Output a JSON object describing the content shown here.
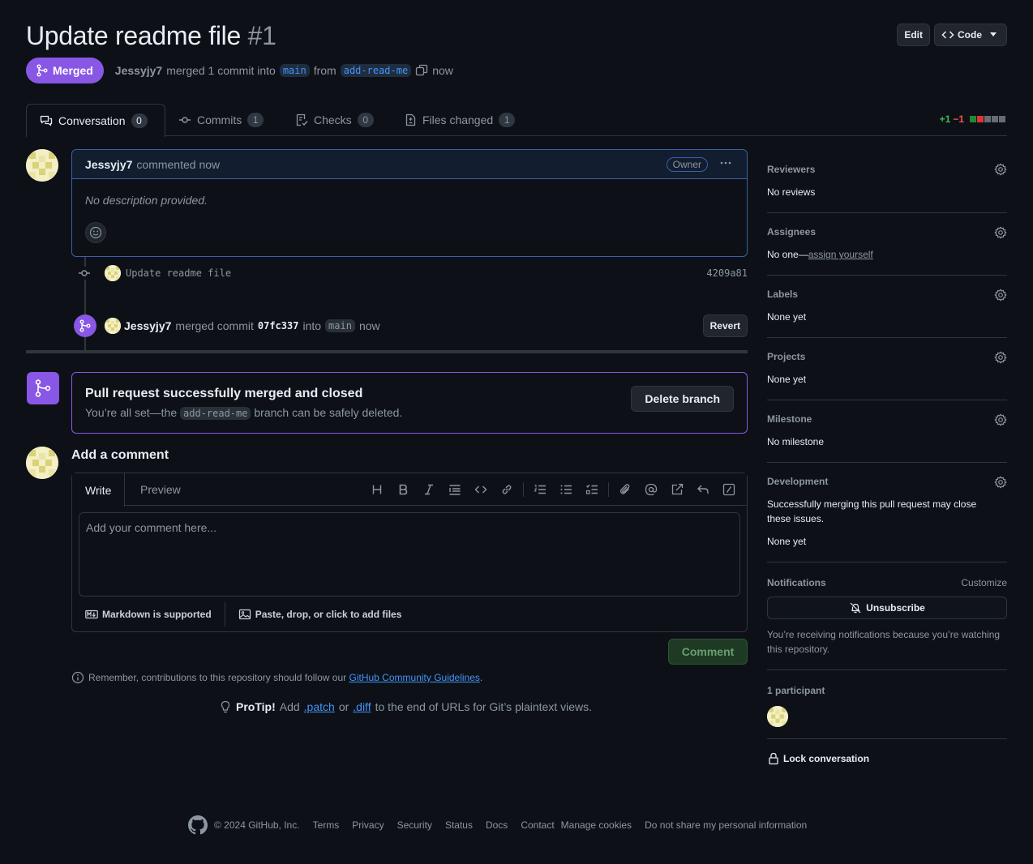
{
  "pr": {
    "title": "Update readme file",
    "number": "#1",
    "state": "Merged",
    "author": "Jessyjy7",
    "merge_text": "merged 1 commit into",
    "base_branch": "main",
    "from_text": "from",
    "head_branch": "add-read-me",
    "time": "now"
  },
  "header_buttons": {
    "edit": "Edit",
    "code": "Code"
  },
  "tabs": [
    {
      "label": "Conversation",
      "count": "0"
    },
    {
      "label": "Commits",
      "count": "1"
    },
    {
      "label": "Checks",
      "count": "0"
    },
    {
      "label": "Files changed",
      "count": "1"
    }
  ],
  "diffstat": {
    "additions": "+1",
    "deletions": "−1",
    "blocks": [
      "#da3633",
      "#da3633",
      "#656c76",
      "#656c76",
      "#656c76"
    ],
    "first_block": "#238636"
  },
  "comment": {
    "author": "Jessyjy7",
    "action": "commented now",
    "badge": "Owner",
    "body": "No description provided."
  },
  "commit": {
    "message": "Update readme file",
    "sha": "4209a81"
  },
  "merge_event": {
    "author": "Jessyjy7",
    "text1": "merged commit",
    "sha": "07fc337",
    "text2": "into",
    "branch": "main",
    "time": "now",
    "revert": "Revert"
  },
  "merge_box": {
    "title": "Pull request successfully merged and closed",
    "text1": "You’re all set—the",
    "branch": "add-read-me",
    "text2": "branch can be safely deleted.",
    "button": "Delete branch"
  },
  "add_comment": {
    "title": "Add a comment",
    "tab_write": "Write",
    "tab_preview": "Preview",
    "placeholder": "Add your comment here...",
    "markdown": "Markdown is supported",
    "attach": "Paste, drop, or click to add files",
    "button": "Comment"
  },
  "remember": {
    "text": "Remember, contributions to this repository should follow our",
    "link": "GitHub Community Guidelines",
    "end": "."
  },
  "protip": {
    "label": "ProTip!",
    "t1": "Add",
    "patch": ".patch",
    "t2": "or",
    "diff": ".diff",
    "t3": "to the end of URLs for Git’s plaintext views."
  },
  "sidebar": {
    "reviewers": {
      "title": "Reviewers",
      "value": "No reviews"
    },
    "assignees": {
      "title": "Assignees",
      "value": "No one—",
      "link": "assign yourself"
    },
    "labels": {
      "title": "Labels",
      "value": "None yet"
    },
    "projects": {
      "title": "Projects",
      "value": "None yet"
    },
    "milestone": {
      "title": "Milestone",
      "value": "No milestone"
    },
    "development": {
      "title": "Development",
      "desc": "Successfully merging this pull request may close these issues.",
      "value": "None yet"
    },
    "notifications": {
      "title": "Notifications",
      "customize": "Customize",
      "button": "Unsubscribe",
      "note": "You’re receiving notifications because you’re watching this repository."
    },
    "participants": {
      "title": "1 participant"
    },
    "lock": "Lock conversation"
  },
  "footer": {
    "copyright": "© 2024 GitHub, Inc.",
    "links": [
      "Terms",
      "Privacy",
      "Security",
      "Status",
      "Docs",
      "Contact",
      "Manage cookies",
      "Do not share my personal information"
    ]
  },
  "colors": {
    "background": "#0d1117",
    "merged": "#8957e5",
    "link": "#4493f8",
    "success": "#3fb950",
    "danger": "#f85149"
  }
}
